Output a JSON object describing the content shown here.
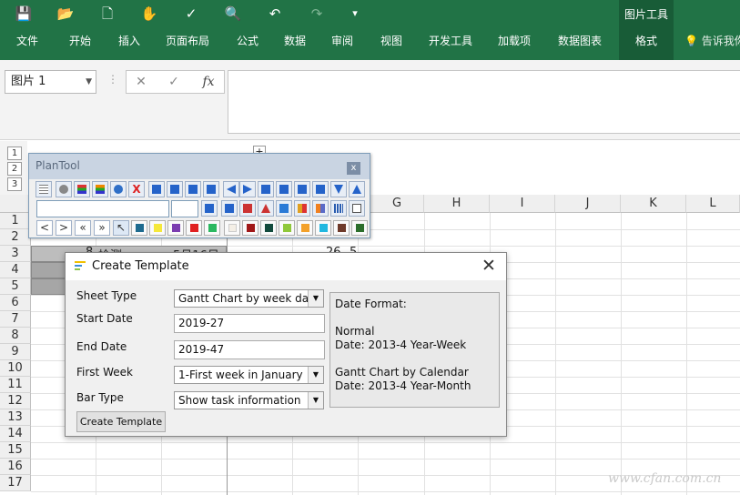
{
  "ribbon": {
    "context_group": "图片工具",
    "tabs": [
      "文件",
      "开始",
      "插入",
      "页面布局",
      "公式",
      "数据",
      "审阅",
      "视图",
      "开发工具",
      "加载项",
      "数据图表",
      "格式"
    ],
    "tell_me": "告诉我你"
  },
  "formula_bar": {
    "name_box": "图片 1",
    "fx": "fx",
    "cancel": "✕",
    "enter": "✓"
  },
  "outline_levels": [
    "1",
    "2",
    "3"
  ],
  "columns": [
    "H",
    "I",
    "J",
    "K",
    "L"
  ],
  "partial_column": "G",
  "rows": [
    "1",
    "2",
    "3",
    "4",
    "5",
    "6",
    "7",
    "8",
    "9",
    "10",
    "11",
    "12",
    "13",
    "14",
    "15",
    "16",
    "17"
  ],
  "cells": {
    "a3": "8",
    "b3": "检测",
    "c3": "5月16日",
    "e3": "26",
    "e3b": "5"
  },
  "plantool": {
    "title": "PlanTool",
    "close": "x",
    "nav": [
      "<",
      ">",
      "«",
      "»"
    ]
  },
  "dialog": {
    "title": "Create Template",
    "close": "✕",
    "sheet_type_label": "Sheet Type",
    "sheet_type_value": "Gantt Chart by week day",
    "start_date_label": "Start Date",
    "start_date_value": "2019-27",
    "end_date_label": "End Date",
    "end_date_value": "2019-47",
    "first_week_label": "First Week",
    "first_week_value": "1-First week in January",
    "bar_type_label": "Bar Type",
    "bar_type_value": "Show task information",
    "create_button": "Create Template",
    "info": {
      "heading": "Date Format:",
      "line1": "Normal",
      "line2": "Date: 2013-4 Year-Week",
      "line3": "Gantt Chart by Calendar",
      "line4": "Date: 2013-4 Year-Month"
    }
  },
  "watermark": "www.cfan.com.cn"
}
